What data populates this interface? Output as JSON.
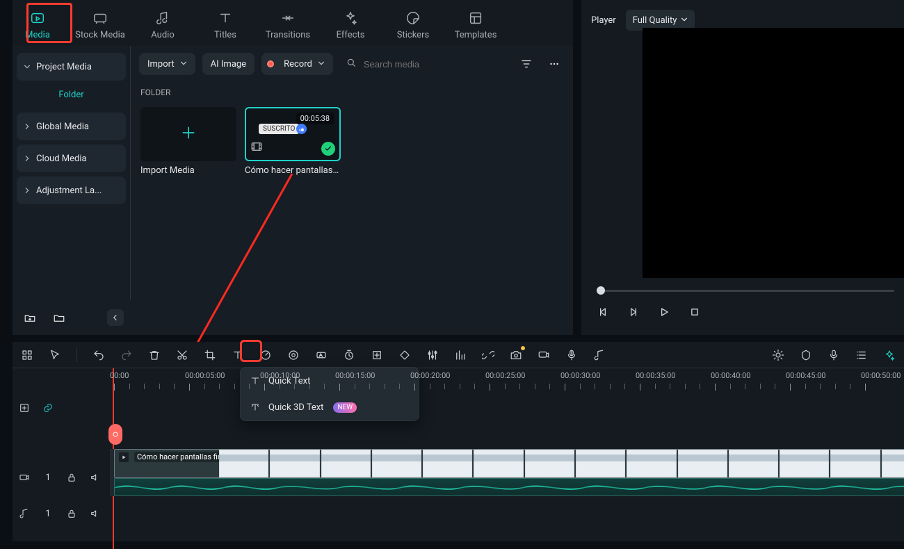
{
  "tabs": {
    "items": [
      {
        "label": "Media",
        "icon": "media"
      },
      {
        "label": "Stock Media",
        "icon": "stock"
      },
      {
        "label": "Audio",
        "icon": "audio"
      },
      {
        "label": "Titles",
        "icon": "titles"
      },
      {
        "label": "Transitions",
        "icon": "transitions"
      },
      {
        "label": "Effects",
        "icon": "effects"
      },
      {
        "label": "Stickers",
        "icon": "stickers"
      },
      {
        "label": "Templates",
        "icon": "templates"
      }
    ],
    "activeIndex": 0
  },
  "sidebar": {
    "projectMedia": "Project Media",
    "folder": "Folder",
    "globalMedia": "Global Media",
    "cloudMedia": "Cloud Media",
    "adjustmentLayer": "Adjustment La..."
  },
  "mediaToolbar": {
    "import": "Import",
    "aiImage": "AI Image",
    "record": "Record",
    "searchPlaceholder": "Search media"
  },
  "folderSection": {
    "label": "FOLDER",
    "importMedia": "Import Media",
    "clipName": "Cómo hacer pantallas ...",
    "clipDuration": "00:05:38",
    "clipTag": "SUSCRITO"
  },
  "player": {
    "title": "Player",
    "quality": "Full Quality"
  },
  "timeline": {
    "ruler": [
      "00:00",
      "00:00:05:00",
      "00:00:10:00",
      "00:00:15:00",
      "00:00:20:00",
      "00:00:25:00",
      "00:00:30:00",
      "00:00:35:00",
      "00:00:40:00",
      "00:00:45:00",
      "00:00:50:00"
    ],
    "menu": {
      "quickText": "Quick Text",
      "quick3d": "Quick 3D Text",
      "newBadge": "NEW"
    },
    "clipTitle": "Cómo hacer pantallas finales"
  },
  "trackLabels": {
    "video": "1",
    "audio": "1"
  }
}
